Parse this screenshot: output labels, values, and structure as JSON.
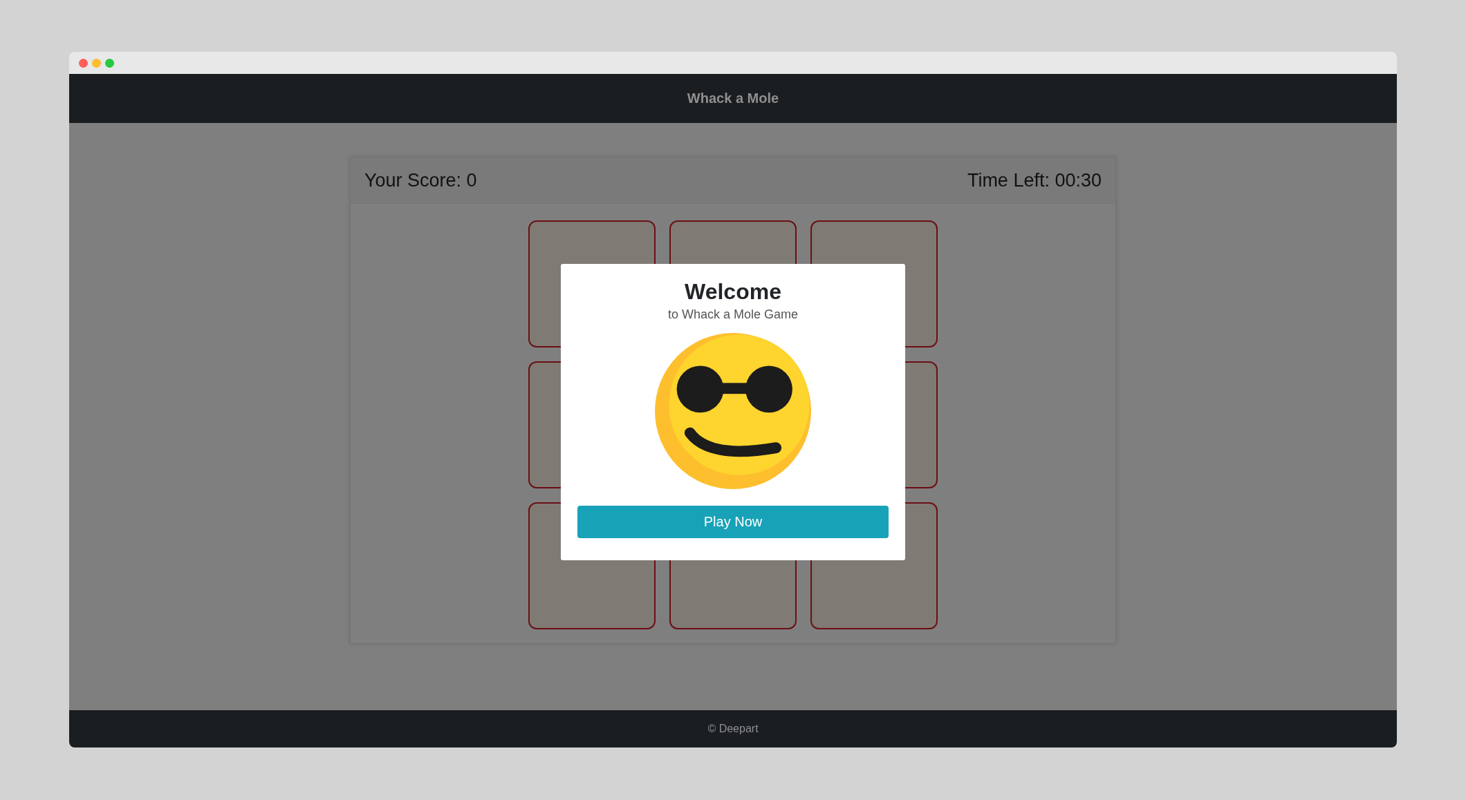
{
  "window": {
    "controls": [
      {
        "kind": "close"
      },
      {
        "kind": "minimize"
      },
      {
        "kind": "maximize"
      }
    ]
  },
  "navbar": {
    "title": "Whack a Mole"
  },
  "scoreboard": {
    "score": "Your Score: 0",
    "time_left": "Time Left: 00:30"
  },
  "holes": [
    {
      "kind": "empty"
    },
    {
      "kind": "empty"
    },
    {
      "kind": "empty"
    },
    {
      "kind": "empty"
    },
    {
      "kind": "empty"
    },
    {
      "kind": "empty"
    },
    {
      "kind": "empty"
    },
    {
      "kind": "empty"
    }
  ],
  "modal": {
    "title": "Welcome",
    "subtitle": "to Whack a Mole Game",
    "button": "Play Now"
  },
  "footer": {
    "text": "© Deepart"
  }
}
